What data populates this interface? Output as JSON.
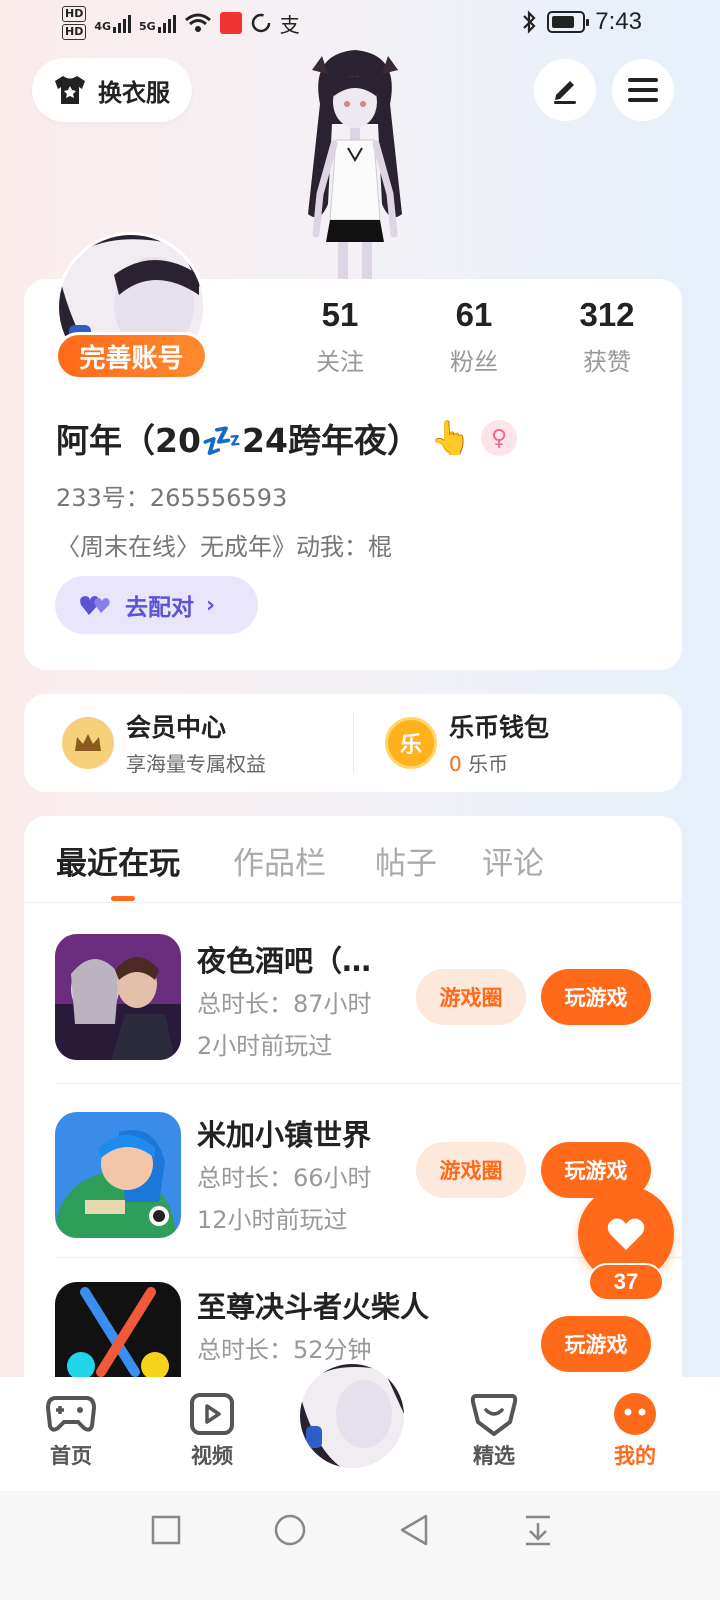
{
  "status_bar": {
    "hd1": "HD",
    "hd2": "HD",
    "net1": "4G",
    "net2": "5G",
    "time": "7:43",
    "icons": [
      "signal-icon",
      "wifi-icon",
      "bluetooth-icon",
      "battery-icon"
    ]
  },
  "header": {
    "outfit_label": "换衣服",
    "edit_icon": "edit-icon",
    "menu_icon": "menu-icon"
  },
  "profile": {
    "complete_label": "完善账号",
    "stats": [
      {
        "num": "51",
        "label": "关注"
      },
      {
        "num": "61",
        "label": "粉丝"
      },
      {
        "num": "312",
        "label": "获赞"
      }
    ],
    "name_part1": "阿年（20",
    "name_emoji": "💤",
    "name_part2": "24跨年夜）",
    "name_hand_emoji": "👆",
    "gender_symbol": "♀",
    "uid": "233号：265556593",
    "bio": "〈周末在线〉无成年》动我：棍",
    "match_label": "去配对"
  },
  "vip": {
    "member_title": "会员中心",
    "member_sub": "享海量专属权益",
    "wallet_title": "乐币钱包",
    "wallet_amount": "0",
    "wallet_unit": "乐币",
    "wallet_coin_char": "乐"
  },
  "tabs": [
    "最近在玩",
    "作品栏",
    "帖子",
    "评论"
  ],
  "games": [
    {
      "title": "夜色酒吧（…",
      "duration": "总时长：87小时",
      "last_played": "2小时前玩过",
      "circle_label": "游戏圈",
      "play_label": "玩游戏"
    },
    {
      "title": "米加小镇世界",
      "duration": "总时长：66小时",
      "last_played": "12小时前玩过",
      "circle_label": "游戏圈",
      "play_label": "玩游戏"
    },
    {
      "title": "至尊决斗者火柴人",
      "duration": "总时长：52分钟",
      "last_played": "",
      "circle_label": "",
      "play_label": "玩游戏"
    }
  ],
  "like_fab": {
    "count": "37"
  },
  "bottom_nav": [
    {
      "label": "首页",
      "icon": "gamepad-icon"
    },
    {
      "label": "视频",
      "icon": "video-icon"
    },
    {
      "label": "精选",
      "icon": "heart-box-icon"
    },
    {
      "label": "我的",
      "icon": "face-icon"
    }
  ],
  "colors": {
    "accent": "#ff6a1a",
    "match": "#5d52d6"
  }
}
